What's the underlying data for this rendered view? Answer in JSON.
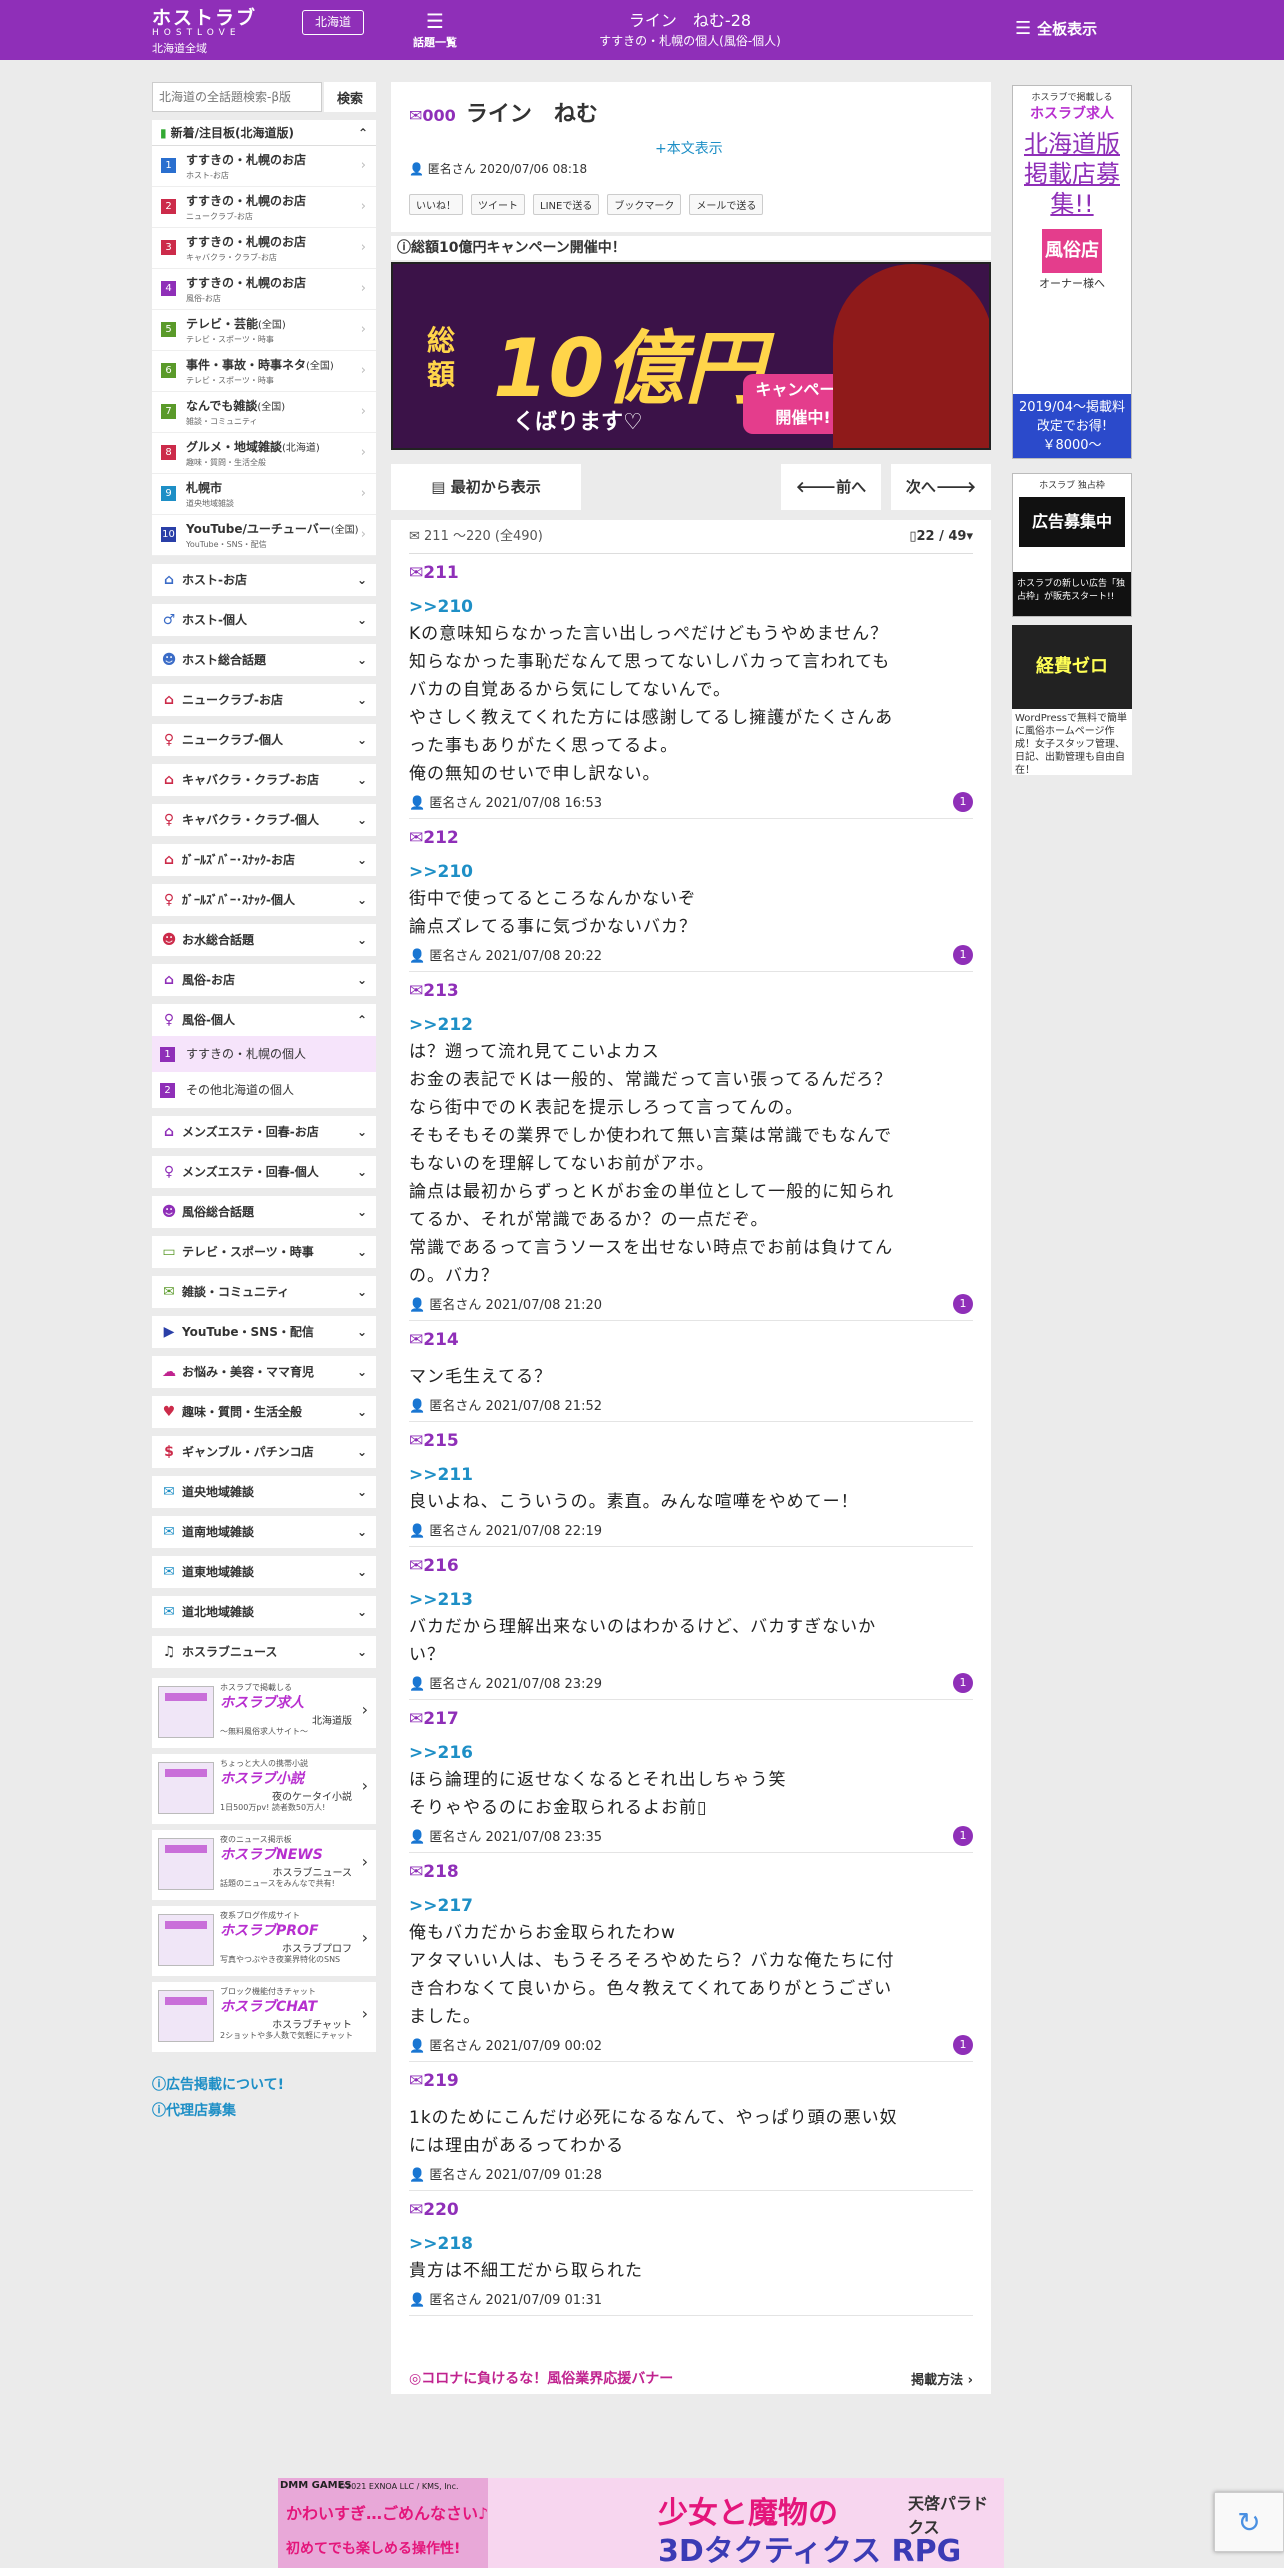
{
  "header": {
    "logo_main": "ホストラブ",
    "logo_sub": "HOSTLOVE",
    "logo_region": "北海道全域",
    "region_button": "北海道",
    "topics_label": "話題一覧",
    "title": "ライン　ねむ-28",
    "subtitle": "すすきの・札幌の個人(風俗-個人)",
    "all_boards": "全板表示"
  },
  "search": {
    "placeholder": "北海道の全話題検索-β版",
    "button": "検索"
  },
  "new_box": {
    "heading": "新着/注目板(北海道版)",
    "items": [
      {
        "num": "1",
        "color": "#2a6fcf",
        "name": "すすきの・札幌のお店",
        "tag": "",
        "sub": "ホスト-お店"
      },
      {
        "num": "2",
        "color": "#cc2b4a",
        "name": "すすきの・札幌のお店",
        "tag": "",
        "sub": "ニュークラブ-お店"
      },
      {
        "num": "3",
        "color": "#cc2b4a",
        "name": "すすきの・札幌のお店",
        "tag": "",
        "sub": "キャバクラ・クラブ-お店"
      },
      {
        "num": "4",
        "color": "#8f2fb8",
        "name": "すすきの・札幌のお店",
        "tag": "",
        "sub": "風俗-お店"
      },
      {
        "num": "5",
        "color": "#5a9a2a",
        "name": "テレビ・芸能",
        "tag": "(全国)",
        "sub": "テレビ・スポーツ・時事"
      },
      {
        "num": "6",
        "color": "#5a9a2a",
        "name": "事件・事故・時事ネタ",
        "tag": "(全国)",
        "sub": "テレビ・スポーツ・時事"
      },
      {
        "num": "7",
        "color": "#5a9a2a",
        "name": "なんでも雑談",
        "tag": "(全国)",
        "sub": "雑談・コミュニティ"
      },
      {
        "num": "8",
        "color": "#cc2b4a",
        "name": "グルメ・地域雑談",
        "tag": "(北海道)",
        "sub": "趣味・質問・生活全般"
      },
      {
        "num": "9",
        "color": "#1e8fc6",
        "name": "札幌市",
        "tag": "",
        "sub": "道央地域雑談"
      },
      {
        "num": "10",
        "color": "#2a3fa8",
        "name": "YouTube/ユーチューバー",
        "tag": "(全国)",
        "sub": "YouTube・SNS・配信"
      }
    ]
  },
  "categories": [
    {
      "icon": "⌂",
      "color": "#3b6cc7",
      "label": "ホスト-お店",
      "open": "⌄"
    },
    {
      "icon": "♂",
      "color": "#3b6cc7",
      "label": "ホスト-個人",
      "open": "⌄"
    },
    {
      "icon": "☻",
      "color": "#3b6cc7",
      "label": "ホスト総合話題",
      "open": "⌄"
    },
    {
      "icon": "⌂",
      "color": "#cc2b4a",
      "label": "ニュークラブ-お店",
      "open": "⌄"
    },
    {
      "icon": "♀",
      "color": "#cc2b4a",
      "label": "ニュークラブ-個人",
      "open": "⌄"
    },
    {
      "icon": "⌂",
      "color": "#cc2b4a",
      "label": "キャバクラ・クラブ-お店",
      "open": "⌄"
    },
    {
      "icon": "♀",
      "color": "#cc2b4a",
      "label": "キャバクラ・クラブ-個人",
      "open": "⌄"
    },
    {
      "icon": "⌂",
      "color": "#cc2b4a",
      "label": "ｶﾞｰﾙｽﾞﾊﾞｰ･ｽﾅｯｸ-お店",
      "open": "⌄"
    },
    {
      "icon": "♀",
      "color": "#cc2b4a",
      "label": "ｶﾞｰﾙｽﾞﾊﾞｰ･ｽﾅｯｸ-個人",
      "open": "⌄"
    },
    {
      "icon": "☻",
      "color": "#cc2b4a",
      "label": "お水総合話題",
      "open": "⌄"
    },
    {
      "icon": "⌂",
      "color": "#8f2fb8",
      "label": "風俗-お店",
      "open": "⌄"
    },
    {
      "icon": "♀",
      "color": "#8f2fb8",
      "label": "風俗-個人",
      "open": "⌃"
    }
  ],
  "subcats": [
    {
      "num": "1",
      "label": "すすきの・札幌の個人"
    },
    {
      "num": "2",
      "label": "その他北海道の個人"
    }
  ],
  "categories2": [
    {
      "icon": "⌂",
      "color": "#8f2fb8",
      "label": "メンズエステ・回春-お店"
    },
    {
      "icon": "♀",
      "color": "#8f2fb8",
      "label": "メンズエステ・回春-個人"
    },
    {
      "icon": "☻",
      "color": "#8f2fb8",
      "label": "風俗総合話題"
    },
    {
      "icon": "▭",
      "color": "#5a9a2a",
      "label": "テレビ・スポーツ・時事"
    },
    {
      "icon": "✉",
      "color": "#5a9a2a",
      "label": "雑談・コミュニティ"
    },
    {
      "icon": "▶",
      "color": "#2a3fa8",
      "label": "YouTube・SNS・配信"
    },
    {
      "icon": "☁",
      "color": "#c0238f",
      "label": "お悩み・美容・ママ育児"
    },
    {
      "icon": "♥",
      "color": "#cc2b4a",
      "label": "趣味・質問・生活全般"
    },
    {
      "icon": "$",
      "color": "#cc2b4a",
      "label": "ギャンブル・パチンコ店"
    },
    {
      "icon": "✉",
      "color": "#1e8fc6",
      "label": "道央地域雑談"
    },
    {
      "icon": "✉",
      "color": "#1e8fc6",
      "label": "道南地域雑談"
    },
    {
      "icon": "✉",
      "color": "#1e8fc6",
      "label": "道東地域雑談"
    },
    {
      "icon": "✉",
      "color": "#1e8fc6",
      "label": "道北地域雑談"
    },
    {
      "icon": "♫",
      "color": "#333333",
      "label": "ホスラブニュース"
    }
  ],
  "service_banners": [
    {
      "small": "ホスラブで掲載しる",
      "brand": "ホスラブ求人",
      "name": "北海道版",
      "desc": "〜無料風俗求人サイト〜"
    },
    {
      "small": "ちょっと大人の携帯小説",
      "brand": "ホスラブ小説",
      "name": "夜のケータイ小説",
      "desc": "1日500万pv! 読者数50万人!"
    },
    {
      "small": "夜のニュース掲示板",
      "brand": "ホスラブNEWS",
      "name": "ホスラブニュース",
      "desc": "話題のニュースをみんなで共有!"
    },
    {
      "small": "夜系ブログ作成サイト",
      "brand": "ホスラブPROF",
      "name": "ホスラブプロフ",
      "desc": "写真やつぶやき夜業界特化のSNS"
    },
    {
      "small": "ブロック機能付きチャット",
      "brand": "ホスラブCHAT",
      "name": "ホスラブチャット",
      "desc": "2ショットや多人数で気軽にチャット"
    }
  ],
  "side_links": [
    "広告掲載について!",
    "代理店募集"
  ],
  "thread": {
    "count": "000",
    "title": "ライン　ねむ",
    "more": "+本文表示",
    "meta": "匿名さん 2020/07/06 08:18",
    "shares": [
      "いいね！",
      "ツイート",
      "LINEで送る",
      "ブックマーク",
      "メールで送る"
    ]
  },
  "campaign": {
    "heading": "総額10億円キャンペーン開催中！",
    "tag": "総額",
    "big": "10億円",
    "sub": "くばります♡",
    "badge1": "キャンペーン",
    "badge2": "開催中!"
  },
  "pager": {
    "first": "最初から表示",
    "prev": "前へ",
    "next": "次へ"
  },
  "posts_head": {
    "range": "211 〜220 (全490)",
    "page": "22 / 49"
  },
  "posts": [
    {
      "no": "211",
      "anchor": ">>210",
      "body": "Kの意味知らなかった言い出しっぺだけどもうやめません？\n知らなかった事恥だなんて思ってないしバカって言われても\nバカの自覚あるから気にしてないんで。\nやさしく教えてくれた方には感謝してるし擁護がたくさんあ\nった事もありがたく思ってるよ。\n俺の無知のせいで申し訳ない。",
      "meta": "匿名さん 2021/07/08 16:53",
      "rep": "1"
    },
    {
      "no": "212",
      "anchor": ">>210",
      "body": "街中で使ってるところなんかないぞ\n論点ズレてる事に気づかないバカ？",
      "meta": "匿名さん 2021/07/08 20:22",
      "rep": "1"
    },
    {
      "no": "213",
      "anchor": ">>212",
      "body": "は？遡って流れ見てこいよカス\nお金の表記でＫは一般的、常識だって言い張ってるんだろ？\nなら街中でのＫ表記を提示しろって言ってんの。\nそもそもその業界でしか使われて無い言葉は常識でもなんで\nもないのを理解してないお前がアホ。\n論点は最初からずっとＫがお金の単位として一般的に知られ\nてるか、それが常識であるか？の一点だぞ。\n常識であるって言うソースを出せない時点でお前は負けてん\nの。バカ？",
      "meta": "匿名さん 2021/07/08 21:20",
      "rep": "1"
    },
    {
      "no": "214",
      "anchor": "",
      "body": "マン毛生えてる？",
      "meta": "匿名さん 2021/07/08 21:52",
      "rep": ""
    },
    {
      "no": "215",
      "anchor": ">>211",
      "body": "良いよね、こういうの。素直。みんな喧嘩をやめてー！",
      "meta": "匿名さん 2021/07/08 22:19",
      "rep": ""
    },
    {
      "no": "216",
      "anchor": ">>213",
      "body": "バカだから理解出来ないのはわかるけど、バカすぎないか\nい？",
      "meta": "匿名さん 2021/07/08 23:29",
      "rep": "1"
    },
    {
      "no": "217",
      "anchor": ">>216",
      "body": "ほら論理的に返せなくなるとそれ出しちゃう笑\nそりゃやるのにお金取られるよお前▯",
      "meta": "匿名さん 2021/07/08 23:35",
      "rep": "1"
    },
    {
      "no": "218",
      "anchor": ">>217",
      "body": "俺もバカだからお金取られたわw\nアタマいい人は、もうそろそろやめたら？バカな俺たちに付\nき合わなくて良いから。色々教えてくれてありがとうござい\nました。",
      "meta": "匿名さん 2021/07/09 00:02",
      "rep": "1"
    },
    {
      "no": "219",
      "anchor": "",
      "body": "1kのためにこんだけ必死になるなんて、やっぱり頭の悪い奴\nには理由があるってわかる",
      "meta": "匿名さん 2021/07/09 01:28",
      "rep": ""
    },
    {
      "no": "220",
      "anchor": ">>218",
      "body": "貴方は不細工だから取られた",
      "meta": "匿名さん 2021/07/09 01:31",
      "rep": ""
    }
  ],
  "corona": {
    "left": "◎コロナに負けるな！風俗業界応援バナー",
    "right": "掲載方法"
  },
  "right_ads": {
    "ad1_small": "ホスラブで掲載しる",
    "ad1_brand": "ホスラブ求人",
    "ad1_main": "北海道版掲載店募集!!",
    "ad1_badge": "風俗店",
    "ad1_owner": "オーナー様へ",
    "ad1_bottom": "2019/04〜掲載料改定でお得!￥8000〜",
    "ad2_small": "ホスラブ 独占枠",
    "ad2_main": "広告募集中",
    "ad2_text": "ホスラブの新しい広告「独占枠」が販売スタート!!",
    "ad3_main": "経費ゼロ",
    "ad3_text": "WordPressで無料で簡単に風俗ホームページ作成！女子スタッフ管理、日記、出勤管理も自由自在！"
  },
  "bottom_ad": {
    "dmm": "DMM GAMES",
    "copyright": "©2021 EXNOA LLC / KMS, Inc.",
    "line1": "かわいすぎ…ごめんなさい♪",
    "line2": "初めてでも楽しめる操作性!",
    "main1": "少女と魔物の",
    "main2": "3Dタクティクス RPG",
    "logo": "天啓パラドクス"
  }
}
